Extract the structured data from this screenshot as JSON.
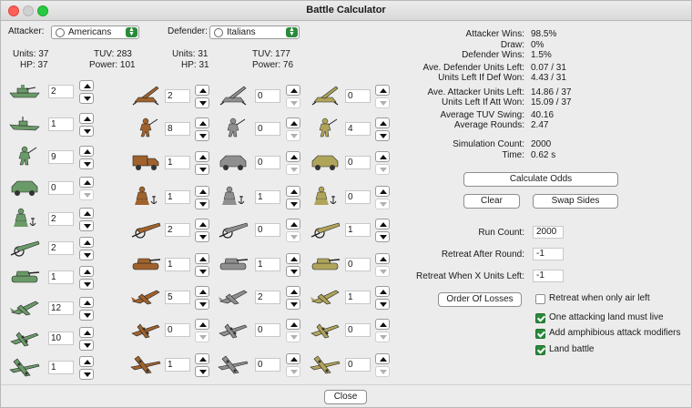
{
  "window": {
    "title": "Battle Calculator"
  },
  "attacker": {
    "label": "Attacker:",
    "nation": "Americans",
    "units": "Units: 37",
    "tuv": "TUV: 283",
    "hp": "HP: 37",
    "power": "Power: 101"
  },
  "defender": {
    "label": "Defender:",
    "nation": "Italians",
    "units": "Units: 31",
    "tuv": "TUV: 177",
    "hp": "HP: 31",
    "power": "Power: 76"
  },
  "colors": {
    "american": "#6a9a68",
    "italian": "#a0622c",
    "ally": "#8f8f8f",
    "axis2": "#b0a45a",
    "accent": "#2a8a3a"
  },
  "attacker_units": [
    {
      "icon": "battleship-icon",
      "count": "2"
    },
    {
      "icon": "cruiser-icon",
      "count": "1"
    },
    {
      "icon": "infantry-icon",
      "count": "9"
    },
    {
      "icon": "mech-infantry-icon",
      "count": "0"
    },
    {
      "icon": "marine-icon",
      "count": "2"
    },
    {
      "icon": "artillery-icon",
      "count": "2"
    },
    {
      "icon": "tank-icon",
      "count": "1"
    },
    {
      "icon": "fighter-icon",
      "count": "12"
    },
    {
      "icon": "tactical-bomber-icon",
      "count": "10"
    },
    {
      "icon": "bomber-icon",
      "count": "1"
    }
  ],
  "defender_units_col1": [
    {
      "icon": "aa-gun-icon",
      "count": "2"
    },
    {
      "icon": "infantry-icon",
      "count": "8"
    },
    {
      "icon": "truck-icon",
      "count": "1"
    },
    {
      "icon": "marine-icon",
      "count": "1"
    },
    {
      "icon": "artillery-icon",
      "count": "2"
    },
    {
      "icon": "tank-icon",
      "count": "1"
    },
    {
      "icon": "fighter-icon",
      "count": "5"
    },
    {
      "icon": "tactical-bomber-icon",
      "count": "0"
    },
    {
      "icon": "bomber-icon",
      "count": "1"
    }
  ],
  "defender_units_col2": [
    {
      "icon": "aa-gun-icon",
      "count": "0"
    },
    {
      "icon": "infantry-icon",
      "count": "0"
    },
    {
      "icon": "mech-infantry-icon",
      "count": "0"
    },
    {
      "icon": "marine-icon",
      "count": "1"
    },
    {
      "icon": "artillery-icon",
      "count": "0"
    },
    {
      "icon": "tank-icon",
      "count": "1"
    },
    {
      "icon": "fighter-icon",
      "count": "2"
    },
    {
      "icon": "tactical-bomber-icon",
      "count": "0"
    },
    {
      "icon": "bomber-icon",
      "count": "0"
    }
  ],
  "defender_units_col3": [
    {
      "icon": "aa-gun-icon",
      "count": "0"
    },
    {
      "icon": "infantry-icon",
      "count": "4"
    },
    {
      "icon": "mech-infantry-icon",
      "count": "0"
    },
    {
      "icon": "marine-icon",
      "count": "0"
    },
    {
      "icon": "artillery-icon",
      "count": "1"
    },
    {
      "icon": "tank-icon",
      "count": "0"
    },
    {
      "icon": "fighter-icon",
      "count": "1"
    },
    {
      "icon": "tactical-bomber-icon",
      "count": "0"
    },
    {
      "icon": "bomber-icon",
      "count": "0"
    }
  ],
  "results": [
    {
      "label": "Attacker Wins:",
      "value": "98.5%"
    },
    {
      "label": "Draw:",
      "value": "0%"
    },
    {
      "label": "Defender Wins:",
      "value": "1.5%"
    },
    {
      "label": "Ave. Defender Units Left:",
      "value": "0.07 / 31"
    },
    {
      "label": "Units Left If Def Won:",
      "value": "4.43 / 31"
    },
    {
      "label": "Ave. Attacker Units Left:",
      "value": "14.86 / 37"
    },
    {
      "label": "Units Left If Att Won:",
      "value": "15.09 / 37"
    },
    {
      "label": "Average TUV Swing:",
      "value": "40.16"
    },
    {
      "label": "Average Rounds:",
      "value": "2.47"
    },
    {
      "label": "Simulation Count:",
      "value": "2000"
    },
    {
      "label": "Time:",
      "value": "0.62 s"
    }
  ],
  "buttons": {
    "calculate": "Calculate Odds",
    "clear": "Clear",
    "swap": "Swap Sides",
    "order": "Order Of Losses",
    "close": "Close"
  },
  "settings": {
    "run_count_label": "Run Count:",
    "run_count": "2000",
    "retreat_round_label": "Retreat After Round:",
    "retreat_round": "-1",
    "retreat_units_label": "Retreat When X Units Left:",
    "retreat_units": "-1"
  },
  "checkboxes": [
    {
      "label": "Retreat when only air left",
      "checked": false
    },
    {
      "label": "One attacking land must live",
      "checked": true
    },
    {
      "label": "Add amphibious attack modifiers",
      "checked": true
    },
    {
      "label": "Land battle",
      "checked": true
    }
  ]
}
